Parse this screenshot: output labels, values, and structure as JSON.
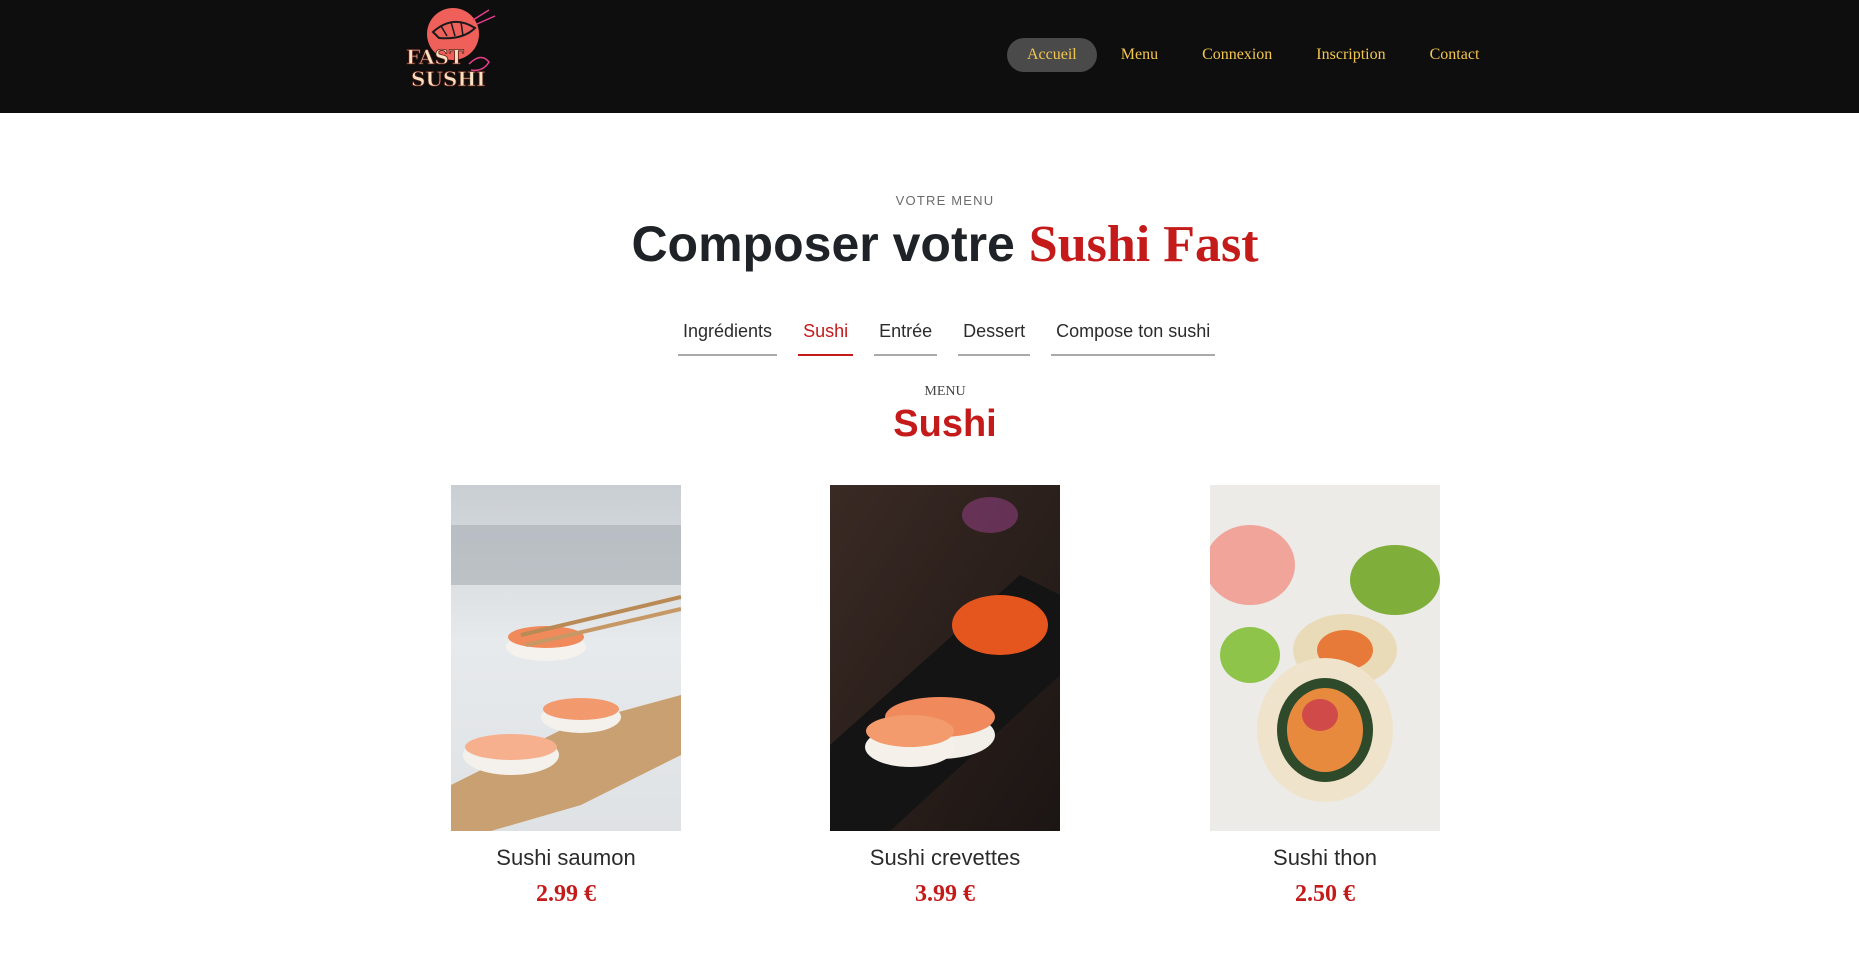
{
  "brand": {
    "logo_text_line1": "FAST",
    "logo_text_line2": "SUSHI",
    "logo_color": "#f0605a"
  },
  "nav": {
    "items": [
      {
        "label": "Accueil",
        "active": true
      },
      {
        "label": "Menu"
      },
      {
        "label": "Connexion"
      },
      {
        "label": "Inscription"
      },
      {
        "label": "Contact"
      }
    ],
    "text_color": "#f3c64f"
  },
  "hero": {
    "eyebrow": "VOTRE MENU",
    "title_plain": "Composer votre",
    "title_accent": "Sushi Fast"
  },
  "tabs": [
    {
      "label": "Ingrédients"
    },
    {
      "label": "Sushi",
      "active": true
    },
    {
      "label": "Entrée"
    },
    {
      "label": "Dessert"
    },
    {
      "label": "Compose ton sushi"
    }
  ],
  "section": {
    "eyebrow": "MENU",
    "title": "Sushi"
  },
  "products": [
    {
      "name": "Sushi saumon",
      "price": "2.99 €",
      "image": "salmon-nigiri-chopsticks-photo"
    },
    {
      "name": "Sushi crevettes",
      "price": "3.99 €",
      "image": "shrimp-nigiri-dark-plate-photo"
    },
    {
      "name": "Sushi thon",
      "price": "2.50 €",
      "image": "tuna-maki-roll-photo"
    }
  ],
  "colors": {
    "accent": "#c41a1a",
    "header_bg": "#0e0e0e",
    "nav_active_bg": "#4a4a4a"
  }
}
